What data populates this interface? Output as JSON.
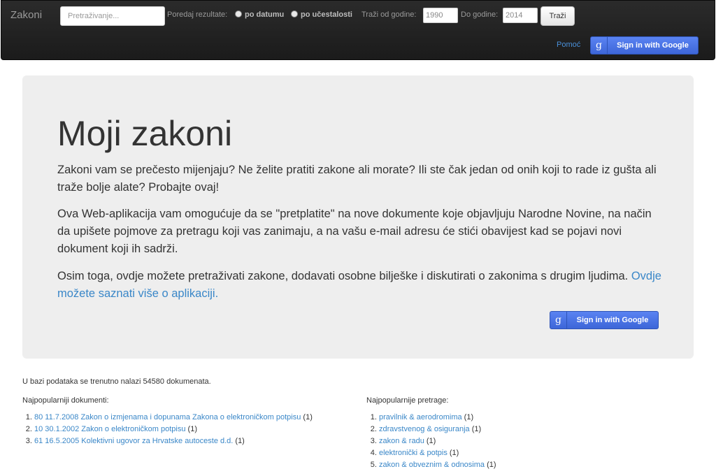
{
  "navbar": {
    "brand": "Zakoni",
    "search_placeholder": "Pretraživanje...",
    "sort_label": "Poredaj rezultate:",
    "sort_options": [
      "po datumu",
      "po učestalosti"
    ],
    "year_from_label": "Traži od godine:",
    "year_from": "1990",
    "year_to_label": "Do godine:",
    "year_to": "2014",
    "search_button": "Traži",
    "help_link": "Pomoć",
    "signin_button": "Sign in with Google",
    "google_icon": "g"
  },
  "hero": {
    "title": "Moji zakoni",
    "p1": "Zakoni vam se prečesto mijenjaju? Ne želite pratiti zakone ali morate? Ili ste čak jedan od onih koji to rade iz gušta ali traže bolje alate? Probajte ovaj!",
    "p2": "Ova Web-aplikacija vam omogućuje da se \"pretplatite\" na nove dokumente koje objavljuju Narodne Novine, na način da upišete pojmove za pretragu koji vas zanimaju, a na vašu e-mail adresu će stići obavijest kad se pojavi novi dokument koji ih sadrži.",
    "p3": "Osim toga, ovdje možete pretraživati zakone, dodavati osobne bilješke i diskutirati o zakonima s drugim ljudima.",
    "p3_link": "Ovdje možete saznati više o aplikaciji.",
    "signin_button": "Sign in with Google"
  },
  "footer": {
    "db_count": "U bazi podataka se trenutno nalazi 54580 dokumenata.",
    "popular_docs_title": "Najpopularniji dokumenti:",
    "popular_docs": [
      {
        "link": "80 11.7.2008 Zakon o izmjenama i dopunama Zakona o elektroničkom potpisu",
        "count": "(1)"
      },
      {
        "link": "10 30.1.2002 Zakon o elektroničkom potpisu",
        "count": "(1)"
      },
      {
        "link": "61 16.5.2005 Kolektivni ugovor za Hrvatske autoceste d.d.",
        "count": "(1)"
      }
    ],
    "popular_searches_title": "Najpopularnije pretrage:",
    "popular_searches": [
      {
        "link": "pravilnik & aerodromima",
        "count": "(1)"
      },
      {
        "link": "zdravstvenog & osiguranja",
        "count": "(1)"
      },
      {
        "link": "zakon & radu",
        "count": "(1)"
      },
      {
        "link": "elektronički & potpis",
        "count": "(1)"
      },
      {
        "link": "zakon & obveznim & odnosima",
        "count": "(1)"
      }
    ]
  }
}
